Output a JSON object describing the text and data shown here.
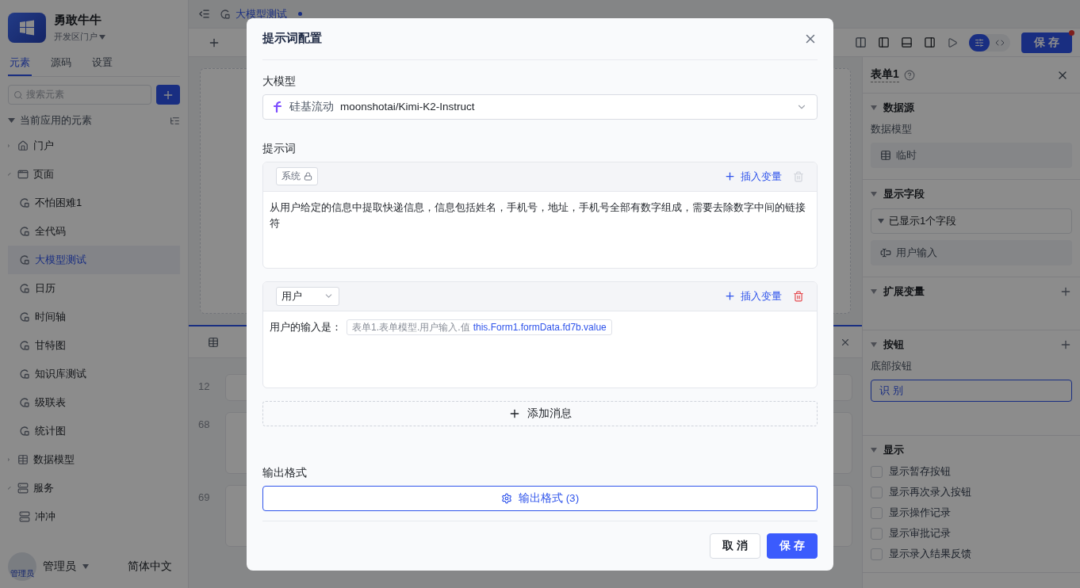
{
  "sidebar": {
    "app_name": "勇敢牛牛",
    "portal": "开发区门户",
    "tabs": [
      {
        "label": "元素",
        "selected": true
      },
      {
        "label": "源码",
        "selected": false
      },
      {
        "label": "设置",
        "selected": false
      }
    ],
    "search": {
      "placeholder": "搜索元素"
    },
    "tree": {
      "label": "当前应用的元素",
      "expanded": true,
      "children": [
        {
          "label": "门户",
          "kind": "portal",
          "expanded": false
        },
        {
          "label": "页面",
          "kind": "folder",
          "expanded": true,
          "children": [
            {
              "label": "不怕困难1",
              "kind": "page",
              "selected": false
            },
            {
              "label": "全代码",
              "kind": "page",
              "selected": false
            },
            {
              "label": "大模型测试",
              "kind": "page",
              "selected": true
            },
            {
              "label": "日历",
              "kind": "page",
              "selected": false
            },
            {
              "label": "时间轴",
              "kind": "page",
              "selected": false
            },
            {
              "label": "甘特图",
              "kind": "page",
              "selected": false
            },
            {
              "label": "知识库测试",
              "kind": "page",
              "selected": false
            },
            {
              "label": "级联表",
              "kind": "page",
              "selected": false
            },
            {
              "label": "统计图",
              "kind": "page",
              "selected": false
            }
          ]
        },
        {
          "label": "数据模型",
          "kind": "model",
          "expanded": false
        },
        {
          "label": "服务",
          "kind": "service",
          "expanded": true,
          "children": [
            {
              "label": "冲冲",
              "kind": "service",
              "selected": false
            }
          ]
        }
      ]
    },
    "user": {
      "avatar_text": "管理员",
      "name": "管理员"
    },
    "language": "简体中文"
  },
  "editor_tabs": [
    {
      "label": "大模型测试",
      "selected": true,
      "unsaved": true
    }
  ],
  "toolbar": {
    "modes": [
      {
        "kind": "design",
        "selected": true
      },
      {
        "kind": "code",
        "selected": false
      }
    ],
    "save": "保 存",
    "has_notice": true
  },
  "canvas": {
    "line_numbers": [
      "12",
      "68",
      "69"
    ]
  },
  "right_panel": {
    "title": "表单1",
    "sections": [
      {
        "title": "数据源",
        "kind": "datasource",
        "addable": false,
        "field_label": "数据模型",
        "value": "临时"
      },
      {
        "title": "显示字段",
        "kind": "fields",
        "addable": false,
        "summary": "已显示1个字段",
        "fields": [
          "用户输入"
        ]
      },
      {
        "title": "扩展变量",
        "kind": "empty",
        "addable": true
      },
      {
        "title": "按钮",
        "kind": "buttons",
        "addable": true,
        "field_label": "底部按钮",
        "buttons": [
          "识 别"
        ]
      },
      {
        "title": "显示",
        "kind": "options",
        "addable": false,
        "options": [
          {
            "label": "显示暂存按钮",
            "checked": false
          },
          {
            "label": "显示再次录入按钮",
            "checked": false
          },
          {
            "label": "显示操作记录",
            "checked": false
          },
          {
            "label": "显示审批记录",
            "checked": false
          },
          {
            "label": "显示录入结果反馈",
            "checked": false
          }
        ]
      }
    ]
  },
  "dialog": {
    "title": "提示词配置",
    "model_label": "大模型",
    "provider": "硅基流动",
    "model": "moonshotai/Kimi-K2-Instruct",
    "prompt_label": "提示词",
    "messages": [
      {
        "kind": "system",
        "role": "系统",
        "locked": true,
        "delete_disabled": true,
        "insert_label": "插入变量",
        "segments": [
          {
            "kind": "text",
            "text": "从用户给定的信息中提取快递信息，信息包括姓名，手机号，地址，手机号全部有数字组成，需要去除数字中间的链接符"
          }
        ]
      },
      {
        "kind": "user",
        "role": "用户",
        "locked": false,
        "delete_disabled": false,
        "insert_label": "插入变量",
        "segments": [
          {
            "kind": "text",
            "text": "用户的输入是："
          },
          {
            "kind": "variable",
            "label": "表单1.表单模型.用户输入.值",
            "expr": "this.Form1.formData.fd7b.value"
          }
        ]
      }
    ],
    "add_message": "添加消息",
    "output_label": "输出格式",
    "output_button": "输出格式 (3)",
    "cancel": "取 消",
    "save": "保 存"
  }
}
